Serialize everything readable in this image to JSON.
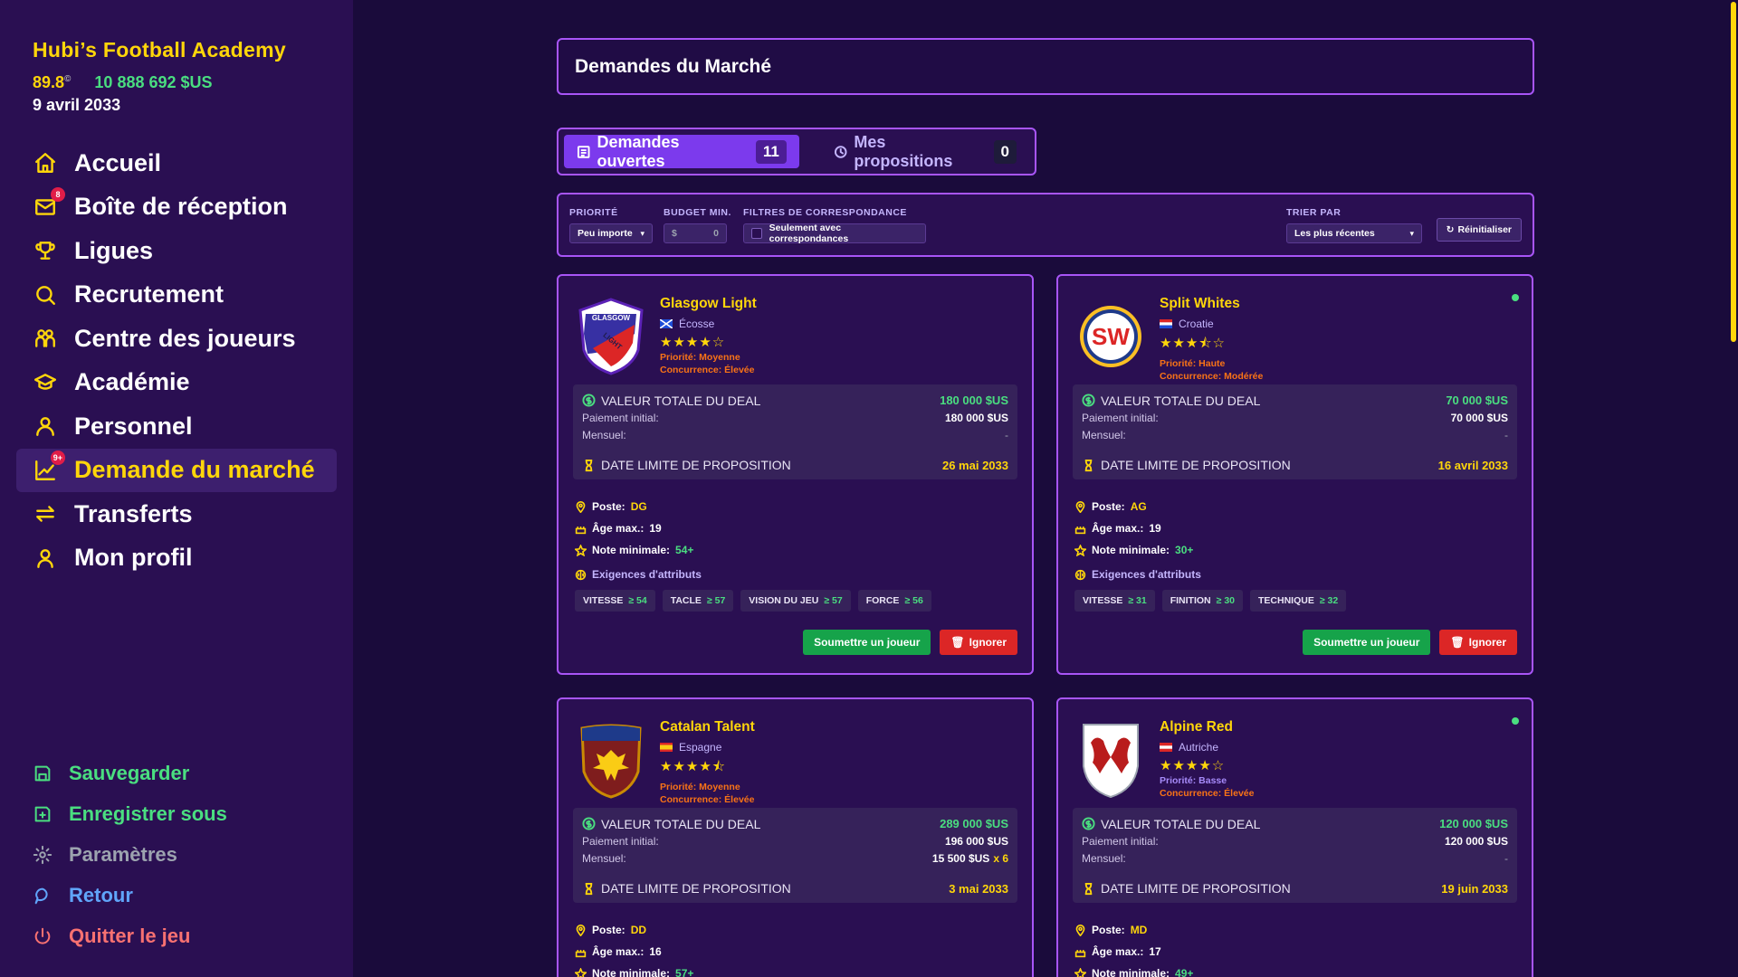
{
  "brand": {
    "title": "Hubi’s Football Academy",
    "rating": "89.8",
    "rating_sup": "©",
    "money": "10 888 692 $US",
    "date": "9 avril 2033"
  },
  "nav": [
    {
      "label": "Accueil",
      "icon": "home-icon"
    },
    {
      "label": "Boîte de réception",
      "icon": "inbox-icon",
      "badge": "8"
    },
    {
      "label": "Ligues",
      "icon": "trophy-icon"
    },
    {
      "label": "Recrutement",
      "icon": "search-icon"
    },
    {
      "label": "Centre des joueurs",
      "icon": "players-icon"
    },
    {
      "label": "Académie",
      "icon": "graduation-cap-icon"
    },
    {
      "label": "Personnel",
      "icon": "staff-icon"
    },
    {
      "label": "Demande du marché",
      "icon": "market-chart-icon",
      "badge": "9+"
    },
    {
      "label": "Transferts",
      "icon": "transfer-icon"
    },
    {
      "label": "Mon profil",
      "icon": "profile-icon"
    }
  ],
  "bottom_nav": [
    {
      "label": "Sauvegarder",
      "icon": "save-icon"
    },
    {
      "label": "Enregistrer sous",
      "icon": "save-as-icon"
    },
    {
      "label": "Paramètres",
      "icon": "gear-icon"
    },
    {
      "label": "Retour",
      "icon": "chat-bubble-icon"
    },
    {
      "label": "Quitter le jeu",
      "icon": "power-icon"
    }
  ],
  "header": {
    "title": "Demandes du Marché"
  },
  "tabs": [
    {
      "label": "Demandes ouvertes",
      "count": "11",
      "icon": "list-icon"
    },
    {
      "label": "Mes propositions",
      "count": "0",
      "icon": "clock-icon"
    }
  ],
  "filters": {
    "priority_label": "PRIORITÉ",
    "priority_value": "Peu importe",
    "budget_label": "BUDGET MIN.",
    "budget_prefix": "$",
    "budget_value": "0",
    "match_label": "FILTRES DE CORRESPONDANCE",
    "match_option": "Seulement avec correspondances",
    "sort_label": "TRIER PAR",
    "sort_value": "Les plus récentes",
    "reset_label": "Réinitialiser"
  },
  "labels": {
    "deal_total": "VALEUR TOTALE DU DEAL",
    "initial": "Paiement initial:",
    "monthly": "Mensuel:",
    "deadline": "DATE LIMITE DE PROPOSITION",
    "position": "Poste:",
    "max_age": "Âge max.:",
    "min_rating": "Note minimale:",
    "attributes": "Exigences d'attributs",
    "submit": "Soumettre un joueur",
    "ignore": "Ignorer",
    "dash": "-"
  },
  "cards": [
    {
      "club": "Glasgow Light",
      "country": "Écosse",
      "stars": "★★★★☆",
      "priority": "Priorité: Moyenne",
      "priority_color": "#f97316",
      "competition": "Concurrence: Élevée",
      "total": "180 000 $US",
      "initial": "180 000 $US",
      "monthly": "-",
      "deadline": "26 mai 2033",
      "position": "DG",
      "max_age": "19",
      "min_rating": "54+",
      "crest_text": "GLASGOW",
      "crest_text2": "LIGHT",
      "attrs": [
        {
          "name": "VITESSE",
          "val": "≥ 54"
        },
        {
          "name": "TACLE",
          "val": "≥ 57"
        },
        {
          "name": "VISION DU JEU",
          "val": "≥ 57"
        },
        {
          "name": "FORCE",
          "val": "≥ 56"
        }
      ]
    },
    {
      "club": "Split Whites",
      "country": "Croatie",
      "stars": "★★★⯪☆",
      "priority": "Priorité: Haute",
      "priority_color": "#f97316",
      "competition": "Concurrence: Modérée",
      "total": "70 000 $US",
      "initial": "70 000 $US",
      "monthly": "-",
      "deadline": "16 avril 2033",
      "position": "AG",
      "max_age": "19",
      "min_rating": "30+",
      "crest_text": "SW",
      "attrs": [
        {
          "name": "VITESSE",
          "val": "≥ 31"
        },
        {
          "name": "FINITION",
          "val": "≥ 30"
        },
        {
          "name": "TECHNIQUE",
          "val": "≥ 32"
        }
      ]
    },
    {
      "club": "Catalan Talent",
      "country": "Espagne",
      "stars": "★★★★⯪",
      "priority": "Priorité: Moyenne",
      "priority_color": "#f97316",
      "competition": "Concurrence: Élevée",
      "total": "289 000 $US",
      "initial": "196 000 $US",
      "monthly": "15 500 $US",
      "monthly_x": "x 6",
      "deadline": "3 mai 2033",
      "position": "DD",
      "max_age": "16",
      "min_rating": "57+"
    },
    {
      "club": "Alpine Red",
      "country": "Autriche",
      "stars": "★★★★☆",
      "priority": "Priorité: Basse",
      "priority_color": "#a78bfa",
      "competition": "Concurrence: Élevée",
      "total": "120 000 $US",
      "initial": "120 000 $US",
      "monthly": "-",
      "deadline": "19 juin 2033",
      "position": "MD",
      "max_age": "17",
      "min_rating": "49+"
    }
  ],
  "colors": {
    "accent": "#ffd60a",
    "border": "#a855f7",
    "green": "#4ade80",
    "bg": "#1a0b3b"
  }
}
